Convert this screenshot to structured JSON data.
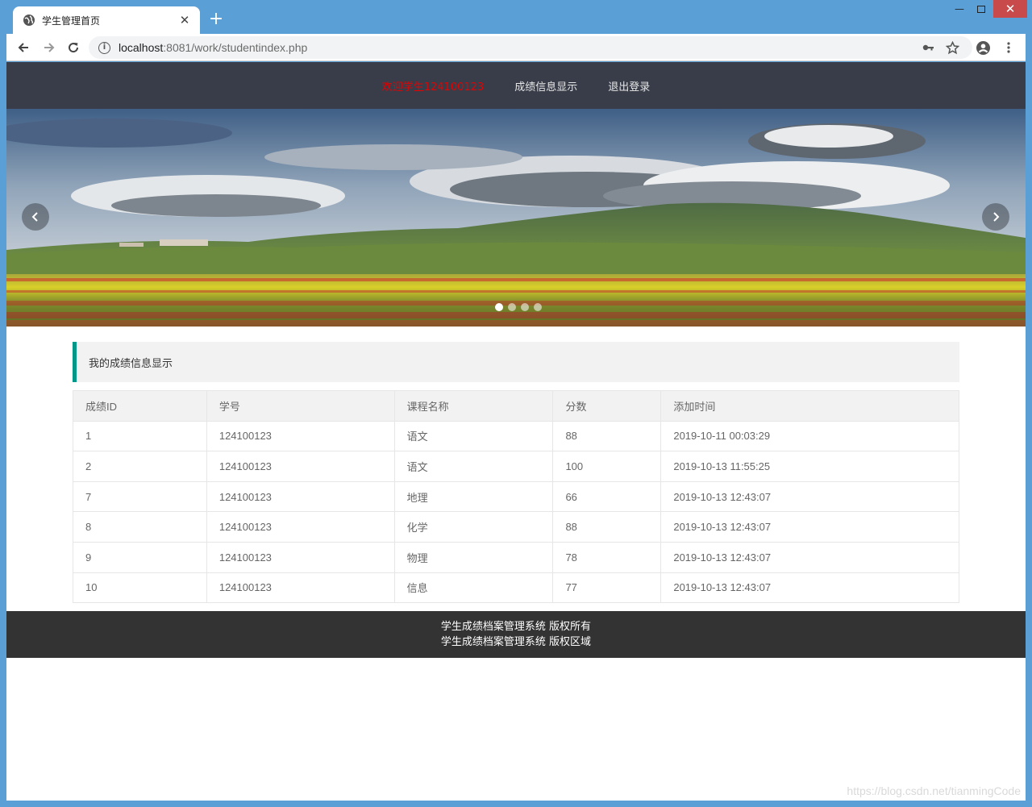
{
  "browser": {
    "tab_title": "学生管理首页",
    "new_tab_glyph": "+",
    "close_tab_glyph": "✕",
    "url_host": "localhost",
    "url_rest": ":8081/work/studentindex.php",
    "icons": [
      "globe-icon",
      "back-icon",
      "forward-icon",
      "reload-icon",
      "info-icon",
      "key-icon",
      "star-icon",
      "account-icon",
      "menu-icon"
    ]
  },
  "nav": {
    "welcome": "欢迎学生124100123",
    "grades_link": "成绩信息显示",
    "logout_link": "退出登录"
  },
  "carousel": {
    "slide_count": 4,
    "active_index": 0
  },
  "section": {
    "title": "我的成绩信息显示"
  },
  "table": {
    "headers": [
      "成绩ID",
      "学号",
      "课程名称",
      "分数",
      "添加时间"
    ],
    "rows": [
      [
        "1",
        "124100123",
        "语文",
        "88",
        "2019-10-11 00:03:29"
      ],
      [
        "2",
        "124100123",
        "语文",
        "100",
        "2019-10-13 11:55:25"
      ],
      [
        "7",
        "124100123",
        "地理",
        "66",
        "2019-10-13 12:43:07"
      ],
      [
        "8",
        "124100123",
        "化学",
        "88",
        "2019-10-13 12:43:07"
      ],
      [
        "9",
        "124100123",
        "物理",
        "78",
        "2019-10-13 12:43:07"
      ],
      [
        "10",
        "124100123",
        "信息",
        "77",
        "2019-10-13 12:43:07"
      ]
    ]
  },
  "footer": {
    "line1": "学生成绩档案管理系统 版权所有",
    "line2": "学生成绩档案管理系统 版权区域"
  },
  "watermark": "https://blog.csdn.net/tianmingCode",
  "colors": {
    "window_frame": "#5a9fd6",
    "nav_bg": "#393d49",
    "welcome_text": "#e60000",
    "accent": "#009688",
    "footer_bg": "#333333"
  }
}
